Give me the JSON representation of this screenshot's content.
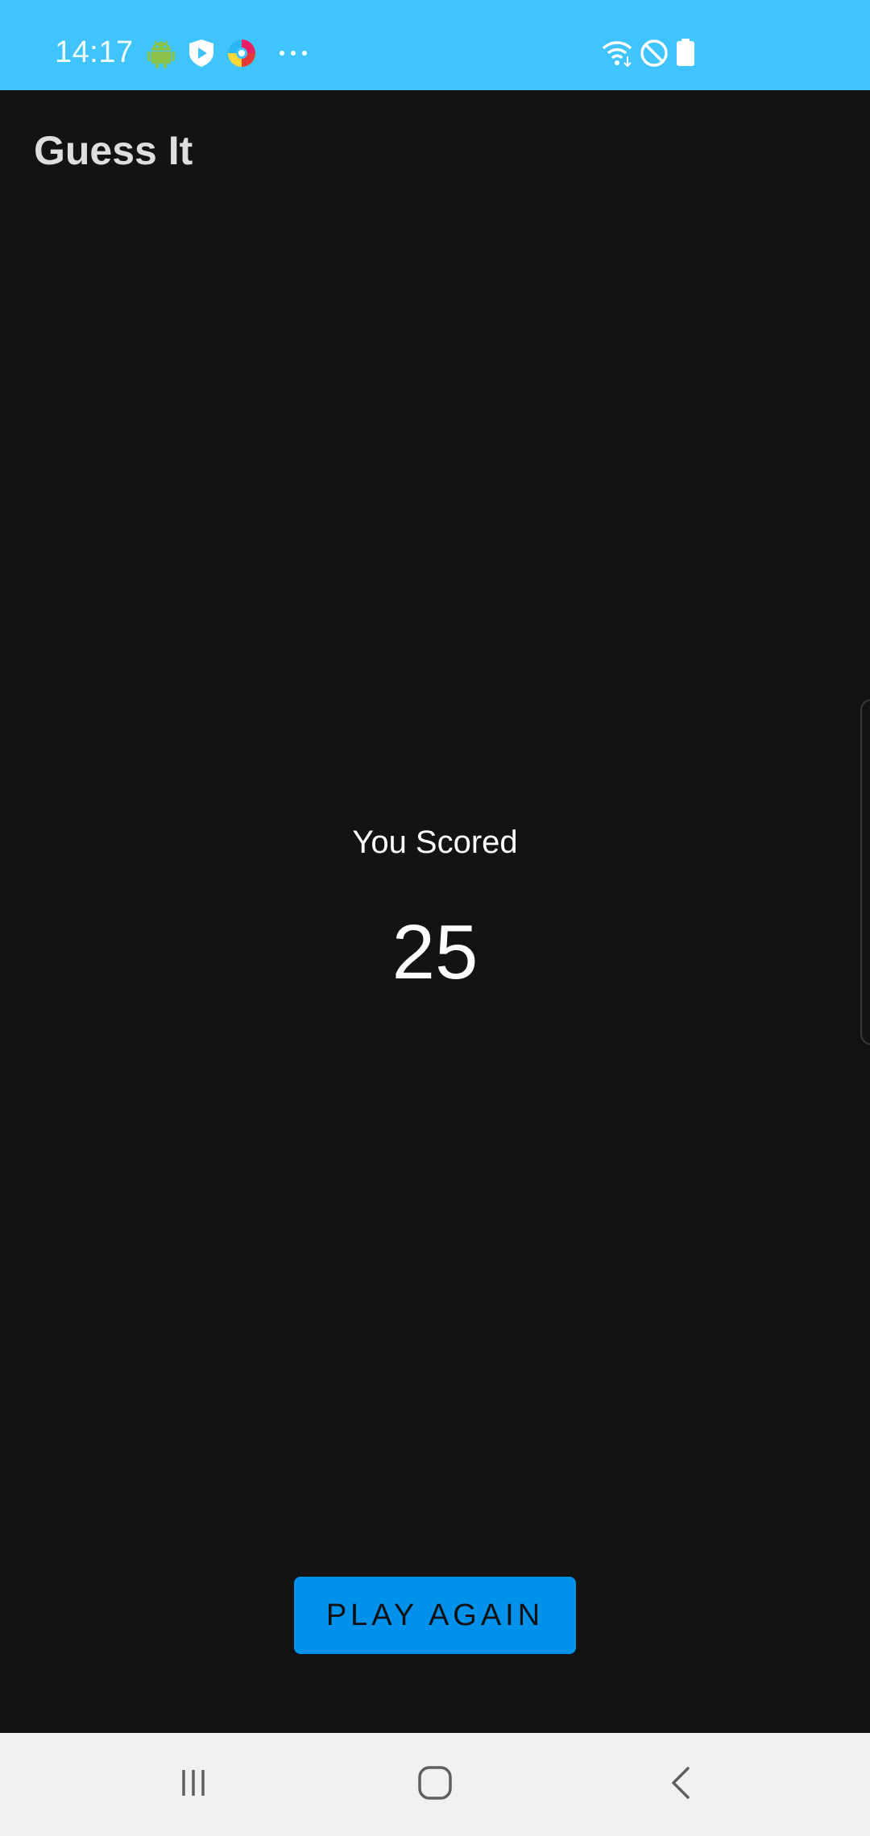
{
  "status_bar": {
    "time": "14:17",
    "background": "#40C4FF",
    "icons_left": [
      "android-icon",
      "shield-play-icon",
      "colorful-app-icon",
      "more-dots-icon"
    ],
    "icons_right": [
      "wifi-icon",
      "do-not-disturb-icon",
      "battery-icon"
    ]
  },
  "app": {
    "title": "Guess It",
    "background": "#131313"
  },
  "score": {
    "label": "You Scored",
    "value": "25"
  },
  "actions": {
    "play_again_label": "PLAY AGAIN",
    "button_color": "#0091EA"
  },
  "nav_bar": {
    "buttons": [
      "recent-apps-icon",
      "home-icon",
      "back-icon"
    ]
  }
}
